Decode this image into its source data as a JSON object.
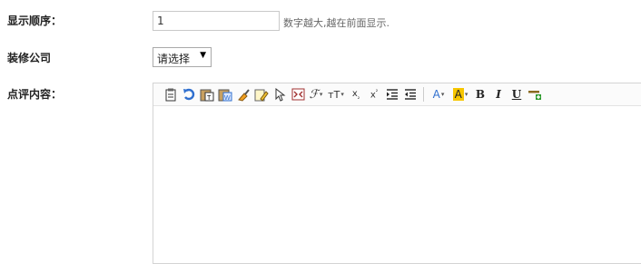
{
  "form": {
    "order_label": "显示顺序：",
    "order_value": "1",
    "order_hint": "数字越大,越在前面显示.",
    "company_label": "装修公司",
    "company_select": "请选择",
    "review_label": "点评内容："
  },
  "editor": {
    "toolbar_icons": [
      "clipboard-icon",
      "undo-icon",
      "paste-text-icon",
      "paste-word-icon",
      "clean-format-icon",
      "eraser-icon",
      "select-all-icon",
      "fullscreen-icon",
      "font-family-icon",
      "font-size-icon",
      "subscript-icon",
      "superscript-icon",
      "indent-icon",
      "outdent-icon",
      "font-color-icon",
      "highlight-color-icon",
      "bold-icon",
      "italic-icon",
      "underline-icon",
      "insert-rule-icon"
    ],
    "font_color_letter": "A",
    "highlight_letter": "A",
    "font_size_label": "тT",
    "bold_label": "B",
    "italic_label": "I",
    "underline_label": "U",
    "accent_highlight": "#f7c600",
    "accent_blue": "#2f6fcf"
  }
}
